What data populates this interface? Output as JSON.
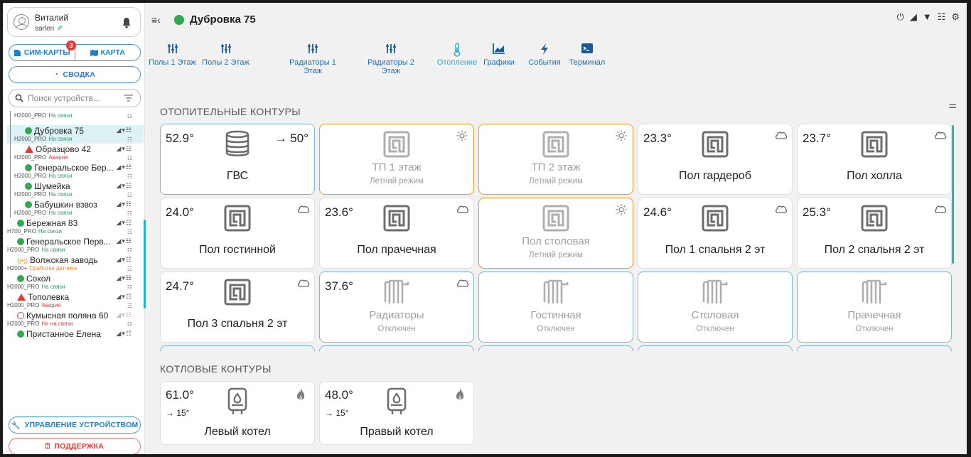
{
  "user": {
    "name": "Виталий",
    "login": "sarlen",
    "icon": "user-avatar-icon"
  },
  "nav": {
    "sim_label": "СИМ-КАРТЫ",
    "sim_badge": "3",
    "map_label": "КАРТА",
    "summary_label": "СВОДКА",
    "search_placeholder": "Поиск устройств...",
    "manage_label": "УПРАВЛЕНИЕ УСТРОЙСТВОМ",
    "support_label": "ПОДДЕРЖКА"
  },
  "devices": [
    {
      "name": "",
      "model": "H2000_PRO",
      "status": "На связи",
      "state": "ok",
      "indent": true,
      "partial": true
    },
    {
      "name": "Дубровка 75",
      "model": "H2000_PRO",
      "status": "На связи",
      "state": "ok",
      "indent": true,
      "selected": true
    },
    {
      "name": "Образцово 42",
      "model": "H2000_PRO",
      "status": "Авария",
      "state": "err",
      "indent": true
    },
    {
      "name": "Генеральское Бер...",
      "model": "H2000_PRO",
      "status": "На связи",
      "state": "ok",
      "indent": true
    },
    {
      "name": "Шумейка",
      "model": "H2000_PRO",
      "status": "На связи",
      "state": "ok",
      "indent": true
    },
    {
      "name": "Бабушкин взвоз",
      "model": "H2000_PRO",
      "status": "На связи",
      "state": "ok",
      "indent": true
    },
    {
      "name": "Бережная 83",
      "model": "H700_PRO",
      "status": "На связи",
      "state": "ok"
    },
    {
      "name": "Генеральское Перв...",
      "model": "H2000_PRO",
      "status": "На связи",
      "state": "ok"
    },
    {
      "name": "Волжская заводь",
      "model": "H2000+",
      "status": "Сработка датчика",
      "state": "warn"
    },
    {
      "name": "Сокол",
      "model": "H2000_PRO",
      "status": "На связи",
      "state": "ok"
    },
    {
      "name": "Тополевка",
      "model": "H1000_PRO",
      "status": "Авария",
      "state": "err"
    },
    {
      "name": "Кумысная поляна 60",
      "model": "H2000_PRO",
      "status": "Не на связи",
      "state": "off"
    },
    {
      "name": "Пристанное Елена",
      "model": "",
      "status": "",
      "state": "ok"
    }
  ],
  "header": {
    "title": "Дубровка 75",
    "status_color": "#2fa84f"
  },
  "tabs": [
    {
      "label": "Полы 1 Этаж",
      "icon": "sliders-icon"
    },
    {
      "label": "Полы 2 Этаж",
      "icon": "sliders-icon"
    },
    {
      "label": "Радиаторы 1 Этаж",
      "icon": "sliders-icon"
    },
    {
      "label": "Радиаторы 2 Этаж",
      "icon": "sliders-icon"
    },
    {
      "label": "Отопление",
      "icon": "thermometer-icon",
      "active": true
    },
    {
      "label": "Графики",
      "icon": "chart-icon"
    },
    {
      "label": "События",
      "icon": "bolt-icon"
    },
    {
      "label": "Терминал",
      "icon": "terminal-icon"
    }
  ],
  "sections": {
    "heating": "ОТОПИТЕЛЬНЫЕ КОНТУРЫ",
    "boilers": "КОТЛОВЫЕ КОНТУРЫ"
  },
  "circuits": [
    {
      "name": "ГВС",
      "temp": "52.9°",
      "target": "→ 50°",
      "icon": "tank-icon",
      "style": "blue",
      "weather": ""
    },
    {
      "name": "ТП 1 этаж",
      "sub": "Летний режим",
      "icon": "floor-icon",
      "style": "orange",
      "weather": "sun-icon"
    },
    {
      "name": "ТП 2 этаж",
      "sub": "Летний режим",
      "icon": "floor-icon",
      "style": "orange",
      "weather": "sun-icon"
    },
    {
      "name": "Пол гардероб",
      "temp": "23.3°",
      "icon": "floor-icon",
      "style": "plain",
      "weather": "cloud-icon"
    },
    {
      "name": "Пол холла",
      "temp": "23.7°",
      "icon": "floor-icon",
      "style": "plain",
      "weather": "cloud-icon"
    },
    {
      "name": "Пол гостинной",
      "temp": "24.0°",
      "icon": "floor-icon",
      "style": "plain",
      "weather": "cloud-icon"
    },
    {
      "name": "Пол прачечная",
      "temp": "23.6°",
      "icon": "floor-icon",
      "style": "plain",
      "weather": "cloud-icon"
    },
    {
      "name": "Пол столовая",
      "sub": "Летний режим",
      "icon": "floor-icon",
      "style": "orange",
      "weather": "sun-icon"
    },
    {
      "name": "Пол 1 спальня 2 эт",
      "temp": "24.6°",
      "icon": "floor-icon",
      "style": "plain",
      "weather": "cloud-icon"
    },
    {
      "name": "Пол 2 спальня 2 эт",
      "temp": "25.3°",
      "icon": "floor-icon",
      "style": "plain",
      "weather": "cloud-icon"
    },
    {
      "name": "Пол 3 спальня 2 эт",
      "temp": "24.7°",
      "icon": "floor-icon",
      "style": "plain",
      "weather": "cloud-icon"
    },
    {
      "name": "Радиаторы",
      "sub": "Отключен",
      "temp": "37.6°",
      "icon": "radiator-icon",
      "style": "blue",
      "weather": "cloud-icon"
    },
    {
      "name": "Гостинная",
      "sub": "Отключен",
      "icon": "radiator-icon",
      "style": "blue",
      "weather": ""
    },
    {
      "name": "Столовая",
      "sub": "Отключен",
      "icon": "radiator-icon",
      "style": "blue",
      "weather": ""
    },
    {
      "name": "Прачечная",
      "sub": "Отключен",
      "icon": "radiator-icon",
      "style": "blue",
      "weather": ""
    }
  ],
  "boilers": [
    {
      "name": "Левый котел",
      "temp": "61.0°",
      "target": "→ 15°",
      "icon": "boiler-icon",
      "flame": "flame-icon"
    },
    {
      "name": "Правый котел",
      "temp": "48.0°",
      "target": "→ 15°",
      "icon": "boiler-icon",
      "flame": "flame-icon"
    }
  ],
  "colors": {
    "accent": "#21b5c5",
    "link": "#1e7fcf",
    "ok": "#2aa06a",
    "error": "#e53935",
    "warning": "#f08a24",
    "summer": "#f29a2e",
    "off_border": "#7ab6d6"
  }
}
